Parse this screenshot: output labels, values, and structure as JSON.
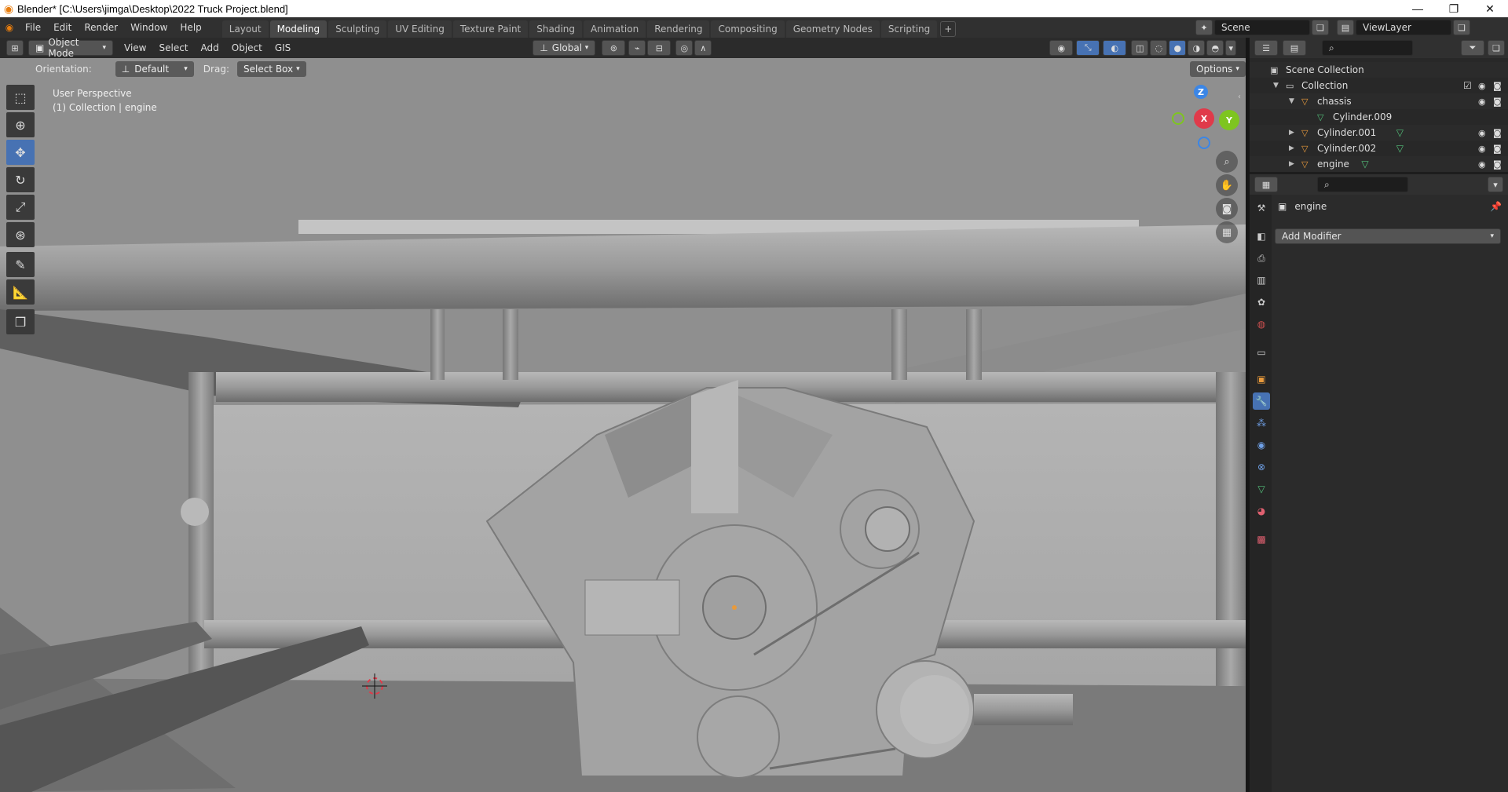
{
  "window": {
    "title": "Blender* [C:\\Users\\jimga\\Desktop\\2022 Truck Project.blend]"
  },
  "menu": [
    "File",
    "Edit",
    "Render",
    "Window",
    "Help"
  ],
  "workspace_tabs": [
    "Layout",
    "Modeling",
    "Sculpting",
    "UV Editing",
    "Texture Paint",
    "Shading",
    "Animation",
    "Rendering",
    "Compositing",
    "Geometry Nodes",
    "Scripting"
  ],
  "active_tab": "Modeling",
  "scene": {
    "name": "Scene",
    "view_layer": "ViewLayer"
  },
  "viewport_header": {
    "mode": "Object Mode",
    "menus": [
      "View",
      "Select",
      "Add",
      "Object",
      "GIS"
    ],
    "transform_orientation": "Global"
  },
  "tool_settings": {
    "orientation_label": "Orientation:",
    "orientation_value": "Default",
    "drag_label": "Drag:",
    "drag_value": "Select Box",
    "options": "Options"
  },
  "viewport": {
    "perspective": "User Perspective",
    "collection_info": "(1) Collection | engine",
    "gizmo_axes": [
      "X",
      "Y",
      "Z"
    ]
  },
  "outliner": {
    "rows": [
      {
        "label": "Scene Collection",
        "indent": 0,
        "type": "scene"
      },
      {
        "label": "Collection",
        "indent": 1,
        "type": "collection",
        "expanded": true
      },
      {
        "label": "chassis",
        "indent": 2,
        "type": "object",
        "expanded": true
      },
      {
        "label": "Cylinder.009",
        "indent": 3,
        "type": "mesh"
      },
      {
        "label": "Cylinder.001",
        "indent": 2,
        "type": "object",
        "expanded": false
      },
      {
        "label": "Cylinder.002",
        "indent": 2,
        "type": "object",
        "expanded": false
      },
      {
        "label": "engine",
        "indent": 2,
        "type": "object",
        "expanded": false
      }
    ]
  },
  "properties": {
    "object_name": "engine",
    "add_modifier": "Add Modifier"
  },
  "colors": {
    "accent": "#4772b3",
    "object_orange": "#e89a3c",
    "mesh_green": "#53c07a",
    "axis_x": "#e03a4a",
    "axis_y": "#7ec520",
    "axis_z": "#3b86e6"
  }
}
